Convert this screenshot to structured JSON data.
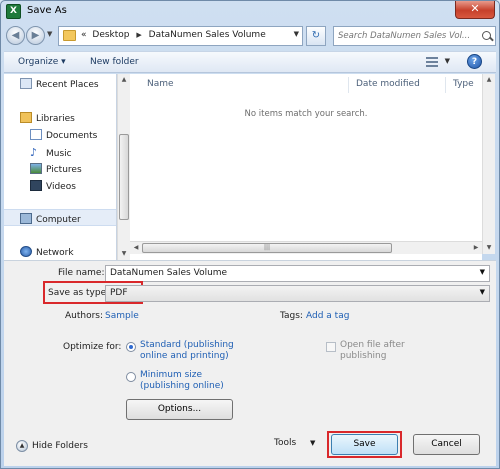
{
  "window": {
    "title": "Save As",
    "app_icon_letter": "X",
    "close_label": "✕"
  },
  "address": {
    "crumb_prefix": "«",
    "crumbs": [
      "Desktop",
      "DataNumen Sales Volume"
    ]
  },
  "search": {
    "placeholder": "Search DataNumen Sales Vol..."
  },
  "toolbar": {
    "organize_label": "Organize ▾",
    "new_folder_label": "New folder",
    "help_label": "?"
  },
  "nav": {
    "recent_places": "Recent Places",
    "libraries": "Libraries",
    "documents": "Documents",
    "music": "Music",
    "pictures": "Pictures",
    "videos": "Videos",
    "computer": "Computer",
    "network": "Network"
  },
  "file_list": {
    "columns": [
      "Name",
      "Date modified",
      "Type"
    ],
    "empty_message": "No items match your search."
  },
  "form": {
    "file_name_label": "File name:",
    "file_name_value": "DataNumen Sales Volume",
    "save_as_type_label": "Save as type:",
    "save_as_type_value": "PDF",
    "authors_label": "Authors:",
    "authors_value": "Sample",
    "tags_label": "Tags:",
    "tags_value": "Add a tag",
    "optimize_label": "Optimize for:",
    "standard_line1": "Standard (publishing",
    "standard_line2": "online and printing)",
    "minimum_line1": "Minimum size",
    "minimum_line2": "(publishing online)",
    "open_after_line1": "Open file after",
    "open_after_line2": "publishing",
    "options_label": "Options...",
    "hide_folders_label": "Hide Folders",
    "tools_label": "Tools",
    "save_label": "Save",
    "cancel_label": "Cancel"
  },
  "colors": {
    "highlight": "#d9282b",
    "link": "#1f5fb4"
  }
}
